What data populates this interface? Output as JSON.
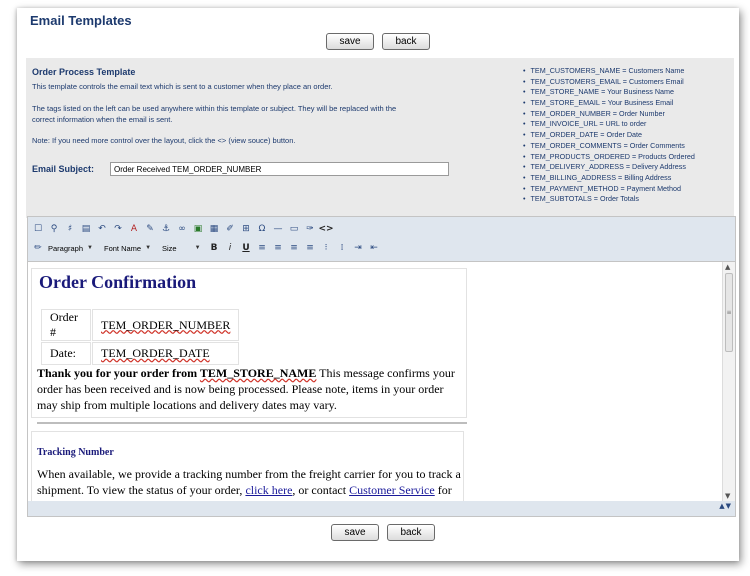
{
  "page": {
    "title": "Email Templates"
  },
  "actions": {
    "save_label": "save",
    "back_label": "back"
  },
  "info": {
    "title": "Order Process Template",
    "description": "This template controls the email text which is sent to a customer when they place an order.",
    "tags_note_line1": "The tags listed on the left can be used anywhere within this template or subject. They will be replaced with the",
    "tags_note_line2": "correct information when the email is sent.",
    "layout_note": "Note: If you need more control over the layout, click the <> (view souce) button.",
    "subject_label": "Email Subject:",
    "subject_value": "Order Received TEM_ORDER_NUMBER"
  },
  "tags": [
    "TEM_CUSTOMERS_NAME = Customers Name",
    "TEM_CUSTOMERS_EMAIL = Customers Email",
    "TEM_STORE_NAME = Your Business Name",
    "TEM_STORE_EMAIL = Your Business Email",
    "TEM_ORDER_NUMBER = Order Number",
    "TEM_INVOICE_URL = URL to order",
    "TEM_ORDER_DATE = Order Date",
    "TEM_ORDER_COMMENTS = Order Comments",
    "TEM_PRODUCTS_ORDERED = Products Ordered",
    "TEM_DELIVERY_ADDRESS = Delivery Address",
    "TEM_BILLING_ADDRESS = Billing Address",
    "TEM_PAYMENT_METHOD = Payment Method",
    "TEM_SUBTOTALS = Order Totals"
  ],
  "toolbar": {
    "format_select": "Paragraph",
    "font_select": "Font Name",
    "size_select": "Size",
    "bold": "B",
    "italic": "i",
    "underline": "U",
    "source": "<>"
  },
  "document": {
    "title": "Order Confirmation",
    "order_label": "Order #",
    "order_value": "TEM_ORDER_NUMBER",
    "date_label": "Date:",
    "date_value": "TEM_ORDER_DATE",
    "thanks_prefix": "Thank you for your order from ",
    "thanks_store": "TEM_STORE_NAME",
    "thanks_rest": " This message confirms your order has been received and is now being processed. Please note, items in your order may ship from multiple locations and delivery dates may vary.",
    "tracking_title": "Tracking Number",
    "tracking_text": "When available, we provide a tracking number from the freight carrier for you to track a shipment. To view the status of your order, ",
    "tracking_link1": "click here",
    "tracking_mid": ", or contact ",
    "tracking_link2": "Customer Service",
    "tracking_end": " for"
  }
}
